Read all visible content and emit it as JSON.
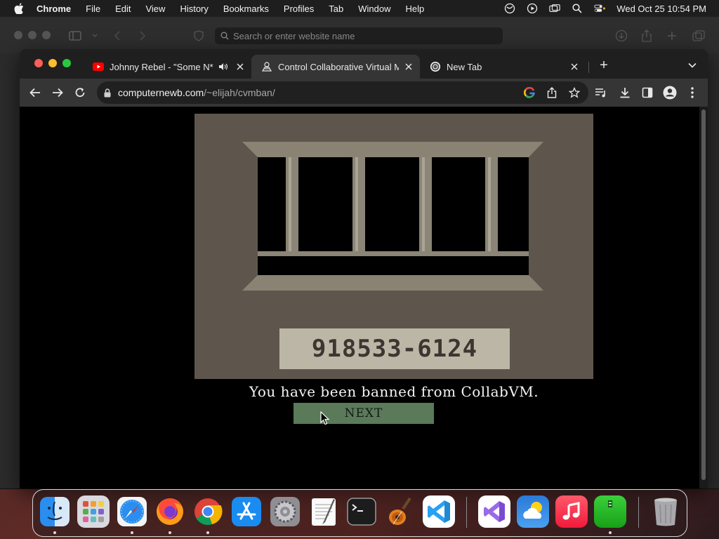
{
  "menubar": {
    "app_name": "Chrome",
    "items": [
      "File",
      "Edit",
      "View",
      "History",
      "Bookmarks",
      "Profiles",
      "Tab",
      "Window",
      "Help"
    ],
    "clock": "Wed Oct 25  10:54 PM"
  },
  "background_window": {
    "address_placeholder": "Search or enter website name"
  },
  "chrome": {
    "tabs": [
      {
        "title": "Johnny Rebel - \"Some N*",
        "favicon": "youtube-icon",
        "audio": true
      },
      {
        "title": "Control Collaborative Virtual M",
        "favicon": "collabvm-icon",
        "active": true
      },
      {
        "title": "New Tab",
        "favicon": "google-icon"
      }
    ],
    "new_tab_label": "+",
    "url_host": "computernewb.com",
    "url_path": "/~elijah/cvmban/"
  },
  "page": {
    "ban_code": "918533-6124",
    "banned_message": "You have been banned from CollabVM.",
    "next_label": "NEXT"
  },
  "dock": {
    "apps": [
      "finder-icon",
      "launchpad-icon",
      "safari-icon",
      "firefox-icon",
      "chrome-icon",
      "app-store-icon",
      "system-settings-icon",
      "textedit-icon",
      "terminal-icon",
      "garageband-icon",
      "vscode-icon",
      "visual-studio-icon",
      "weather-icon",
      "music-icon",
      "gpu-monitor-icon",
      "trash-icon"
    ]
  },
  "colors": {
    "panel": "#5e564c",
    "code_box": "#bcb6a6",
    "next_button": "#5a7a5a"
  }
}
